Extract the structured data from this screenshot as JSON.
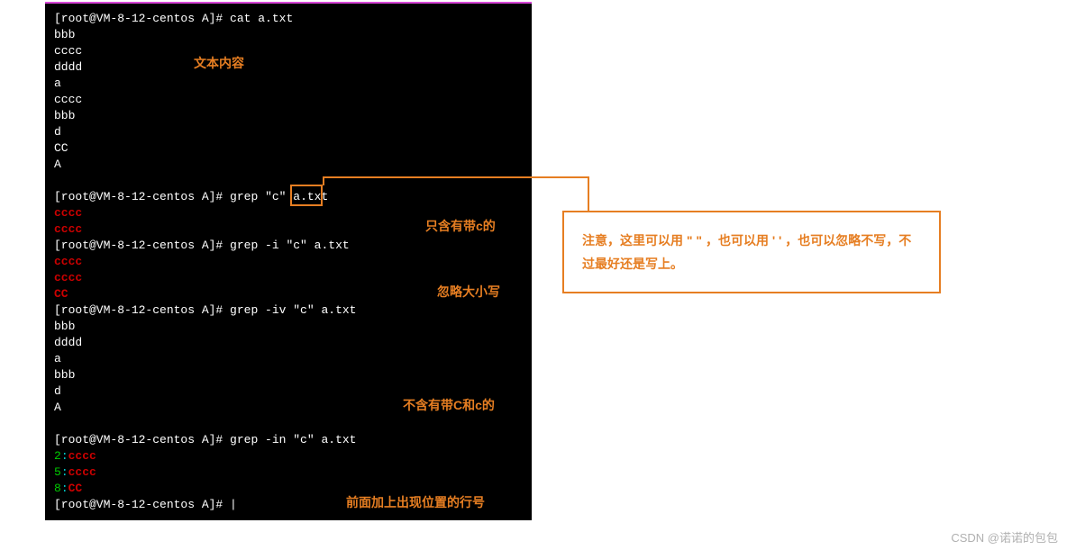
{
  "terminal": {
    "prompt": "[root@VM-8-12-centos A]# ",
    "cmd_cat": "cat a.txt",
    "cat_output": [
      "bbb",
      "cccc",
      "dddd",
      "a",
      "cccc",
      "bbb",
      "d",
      "CC",
      "A"
    ],
    "cmd_grep1_pre": "grep ",
    "cmd_grep1_arg": "\"c\"",
    "cmd_grep1_post": " a.txt",
    "grep1_output": [
      "cccc",
      "cccc"
    ],
    "cmd_grep2": "grep -i \"c\" a.txt",
    "grep2_output": [
      "cccc",
      "cccc",
      "CC"
    ],
    "cmd_grep3": "grep -iv \"c\" a.txt",
    "grep3_output": [
      "bbb",
      "dddd",
      "a",
      "bbb",
      "d",
      "A"
    ],
    "cmd_grep4": "grep -in \"c\" a.txt",
    "grep4_output": [
      {
        "num": "2",
        "sep": ":",
        "text": "cccc"
      },
      {
        "num": "5",
        "sep": ":",
        "text": "cccc"
      },
      {
        "num": "8",
        "sep": ":",
        "text": "CC"
      }
    ],
    "cursor": "|"
  },
  "annotations": {
    "a1": "文本内容",
    "a2": "只含有带c的",
    "a3": "忽略大小写",
    "a4": "不含有带C和c的",
    "a5": "前面加上出现位置的行号"
  },
  "callout": {
    "text": "注意，这里可以用 \" \" ，也可以用  ' ' ，也可以忽略不写，不过最好还是写上。"
  },
  "watermark": "CSDN @诺诺的包包"
}
